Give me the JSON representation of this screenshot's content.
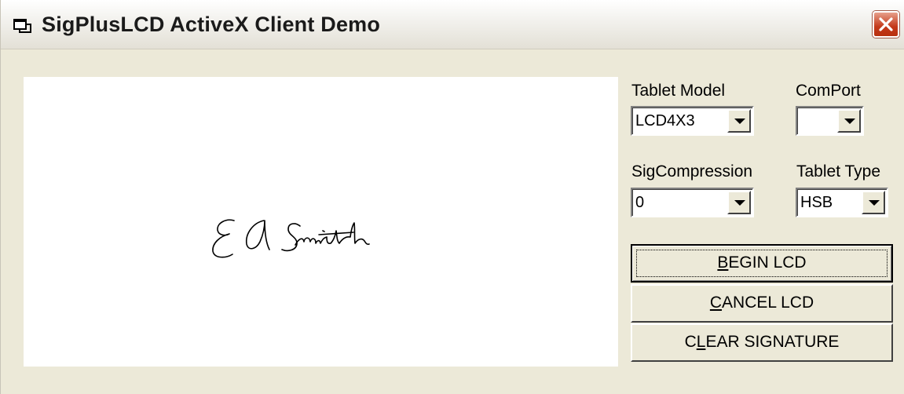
{
  "window": {
    "title": "SigPlusLCD ActiveX Client Demo",
    "close_icon": "close-icon",
    "app_icon": "window-icon"
  },
  "signature": {
    "description": "handwritten signature",
    "stroke_color": "#000000"
  },
  "controls": {
    "tablet_model": {
      "label": "Tablet Model",
      "value": "LCD4X3"
    },
    "com_port": {
      "label": "ComPort",
      "value": ""
    },
    "sig_compression": {
      "label": "SigCompression",
      "value": "0"
    },
    "tablet_type": {
      "label": "Tablet Type",
      "value": "HSB"
    }
  },
  "buttons": {
    "begin_lcd": {
      "mnemonic": "B",
      "rest": "EGIN LCD"
    },
    "cancel_lcd": {
      "mnemonic": "C",
      "rest": "ANCEL LCD"
    },
    "clear_signature": {
      "pre": "C",
      "mnemonic": "L",
      "rest": "EAR SIGNATURE"
    }
  },
  "colors": {
    "face": "#ece9d8",
    "close_button": "#c4391a"
  }
}
